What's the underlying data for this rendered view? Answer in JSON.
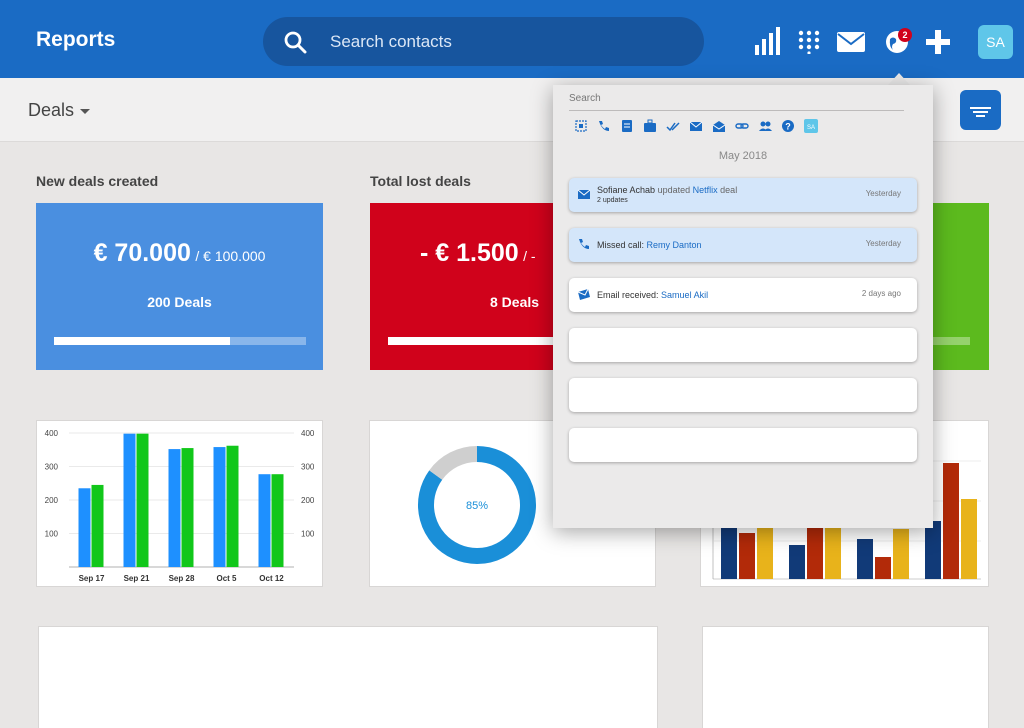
{
  "header": {
    "title": "Reports",
    "search_placeholder": "Search contacts",
    "notification_count": "2",
    "avatar_initials": "SA"
  },
  "subbar": {
    "selector_label": "Deals"
  },
  "cards": {
    "new_deals": {
      "title": "New deals created",
      "value": "€ 70.000",
      "target": "/ € 100.000",
      "deals": "200 Deals",
      "progress": 0.7,
      "color": "#4a8fe0"
    },
    "lost_deals": {
      "title": "Total lost deals",
      "value": "- € 1.500",
      "target": "/ -",
      "deals": "8 Deals",
      "progress": 0.63,
      "color": "#d0021b"
    },
    "third": {
      "color": "#5cba1e"
    }
  },
  "chart_data": [
    {
      "type": "bar",
      "categories": [
        "Sep 17",
        "Sep 21",
        "Sep 28",
        "Oct 5",
        "Oct 12"
      ],
      "series": [
        {
          "values": [
            235,
            398,
            352,
            358,
            277
          ],
          "color": "#1e90ff"
        },
        {
          "values": [
            245,
            398,
            355,
            362,
            277
          ],
          "color": "#11c71a"
        }
      ],
      "ylim": [
        0,
        400
      ],
      "yticks": [
        100,
        200,
        300,
        400
      ],
      "grid": true
    },
    {
      "type": "pie",
      "label": "85%",
      "values": [
        85,
        15
      ],
      "colors": [
        "#1a8fd8",
        "#cfcfcf"
      ]
    }
  ],
  "notifications": {
    "search_placeholder": "Search",
    "month": "May 2018",
    "filter_icons": [
      "all-filter-icon",
      "phone-filter-icon",
      "note-filter-icon",
      "briefcase-filter-icon",
      "check-filter-icon",
      "mail-filter-icon",
      "mail-open-filter-icon",
      "link-filter-icon",
      "people-filter-icon",
      "help-filter-icon",
      "sa-filter-icon"
    ],
    "items": [
      {
        "actor": "Sofiane Achab",
        "verb": "updated",
        "object": "Netflix",
        "suffix": "deal",
        "sub": "2 updates",
        "time": "Yesterday"
      },
      {
        "prefix": "Missed call:",
        "object": "Remy Danton",
        "time": "Yesterday"
      },
      {
        "prefix": "Email received:",
        "object": "Samuel Akil",
        "time": "2 days ago"
      }
    ]
  }
}
